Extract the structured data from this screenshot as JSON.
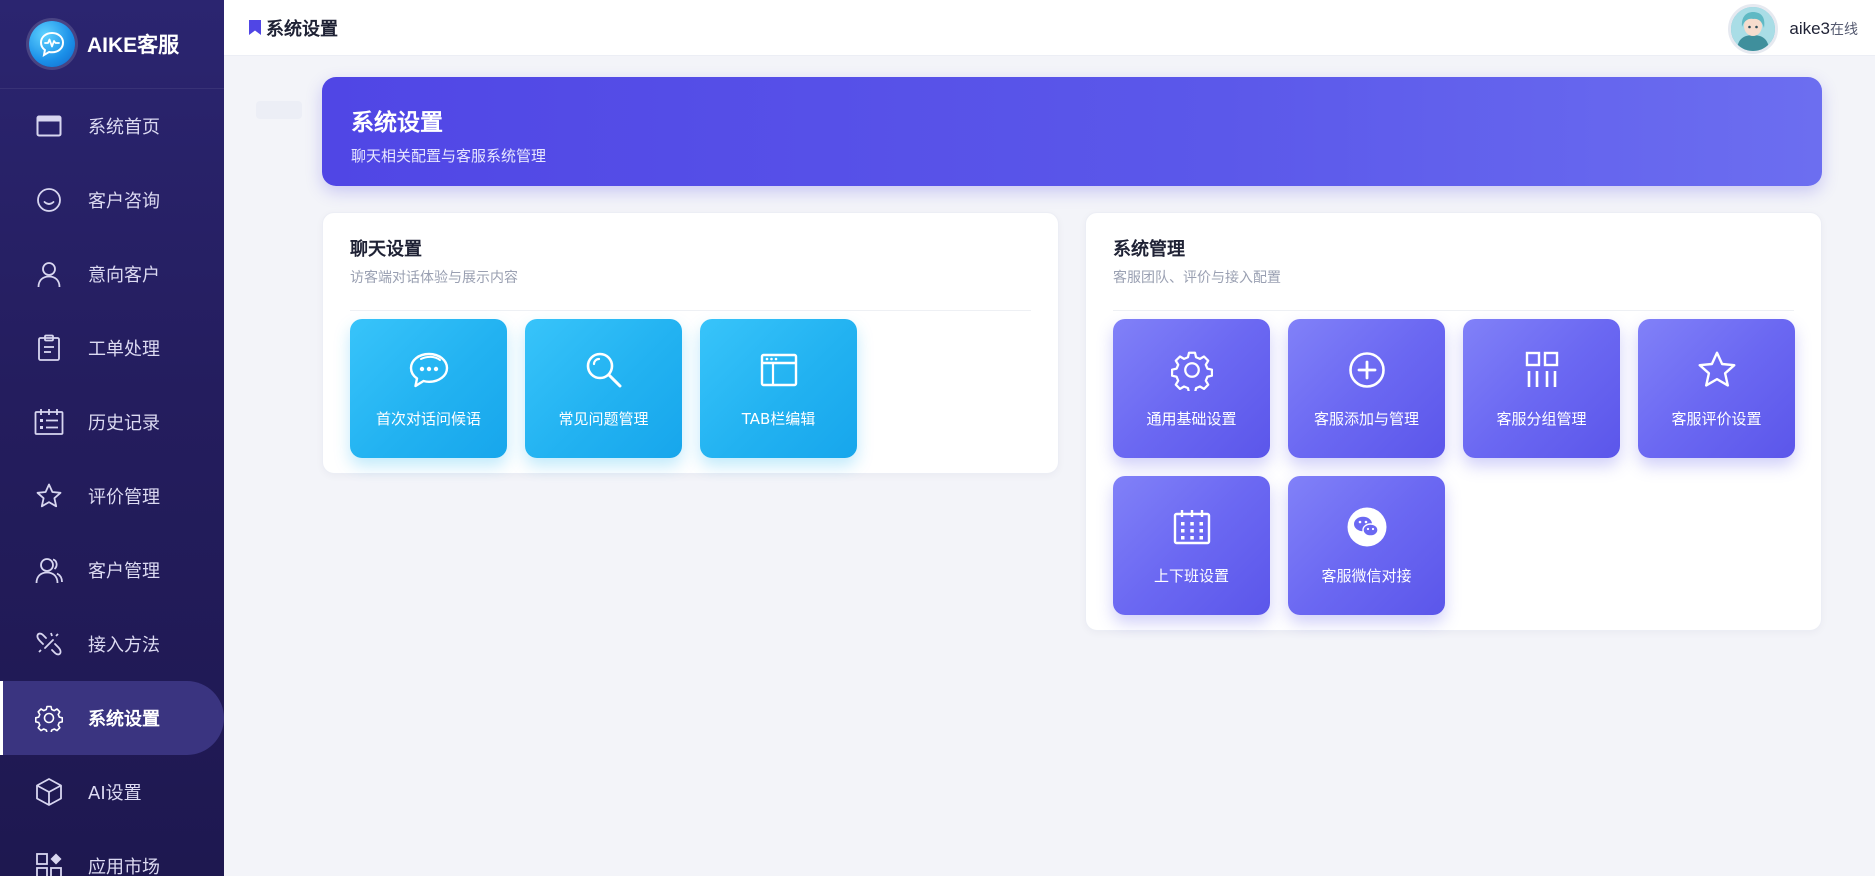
{
  "brand": {
    "name": "AIKE客服",
    "logo_icon": "chat-bubble-wave-icon"
  },
  "sidebar": {
    "items": [
      {
        "label": "系统首页",
        "icon": "window-icon",
        "active": false
      },
      {
        "label": "客户咨询",
        "icon": "smile-chat-icon",
        "active": false
      },
      {
        "label": "意向客户",
        "icon": "user-icon",
        "active": false
      },
      {
        "label": "工单处理",
        "icon": "clipboard-icon",
        "active": false
      },
      {
        "label": "历史记录",
        "icon": "calendar-list-icon",
        "active": false
      },
      {
        "label": "评价管理",
        "icon": "star-icon",
        "active": false
      },
      {
        "label": "客户管理",
        "icon": "users-icon",
        "active": false
      },
      {
        "label": "接入方法",
        "icon": "link-icon",
        "active": false
      },
      {
        "label": "系统设置",
        "icon": "gear-icon",
        "active": true
      },
      {
        "label": "AI设置",
        "icon": "cube-icon",
        "active": false
      },
      {
        "label": "应用市场",
        "icon": "apps-icon",
        "active": false
      }
    ]
  },
  "header": {
    "breadcrumb": "系统设置",
    "user": {
      "name": "aike3",
      "status": "在线"
    }
  },
  "banner": {
    "title": "系统设置",
    "subtitle": "聊天相关配置与客服系统管理"
  },
  "chat_panel": {
    "title": "聊天设置",
    "subtitle": "访客端对话体验与展示内容",
    "tiles": [
      {
        "label": "首次对话问候语",
        "icon": "chat-dots-icon"
      },
      {
        "label": "常见问题管理",
        "icon": "search-icon"
      },
      {
        "label": "TAB栏编辑",
        "icon": "browser-window-icon"
      }
    ]
  },
  "system_panel": {
    "title": "系统管理",
    "subtitle": "客服团队、评价与接入配置",
    "tiles": [
      {
        "label": "通用基础设置",
        "icon": "gear-icon"
      },
      {
        "label": "客服添加与管理",
        "icon": "plus-circle-icon"
      },
      {
        "label": "客服分组管理",
        "icon": "group-columns-icon"
      },
      {
        "label": "客服评价设置",
        "icon": "star-icon"
      },
      {
        "label": "上下班设置",
        "icon": "calendar-icon"
      },
      {
        "label": "客服微信对接",
        "icon": "wechat-icon"
      }
    ]
  },
  "colors": {
    "sidebar_bg": "#2b2570",
    "accent": "#5046e5",
    "tile_cyan": "#22b2f1",
    "tile_violet": "#6b68f2"
  }
}
